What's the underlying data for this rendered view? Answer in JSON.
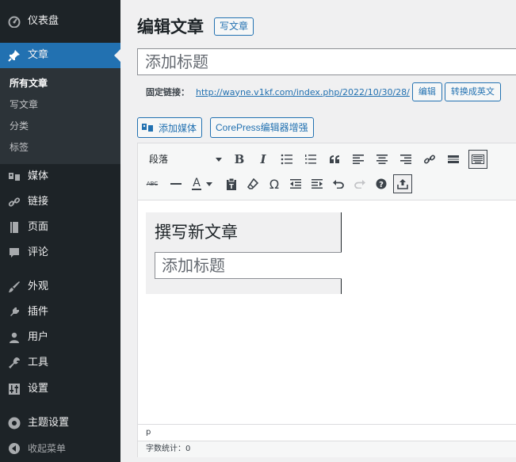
{
  "sidebar": {
    "items": [
      {
        "label": "仪表盘",
        "icon": "dashboard-icon"
      },
      {
        "label": "文章",
        "icon": "pin-icon",
        "active": true
      },
      {
        "label": "媒体",
        "icon": "media-icon"
      },
      {
        "label": "链接",
        "icon": "link-icon"
      },
      {
        "label": "页面",
        "icon": "page-icon"
      },
      {
        "label": "评论",
        "icon": "comment-icon"
      },
      {
        "label": "外观",
        "icon": "brush-icon"
      },
      {
        "label": "插件",
        "icon": "plugin-icon"
      },
      {
        "label": "用户",
        "icon": "user-icon"
      },
      {
        "label": "工具",
        "icon": "wrench-icon"
      },
      {
        "label": "设置",
        "icon": "settings-icon"
      },
      {
        "label": "主题设置",
        "icon": "theme-settings-icon"
      },
      {
        "label": "收起菜单",
        "icon": "collapse-icon"
      }
    ],
    "submenu": [
      {
        "label": "所有文章",
        "current": true
      },
      {
        "label": "写文章"
      },
      {
        "label": "分类"
      },
      {
        "label": "标签"
      }
    ]
  },
  "header": {
    "title": "编辑文章",
    "add_new_label": "写文章"
  },
  "title_field": {
    "placeholder": "添加标题"
  },
  "permalink": {
    "label": "固定链接：",
    "url": "http://wayne.v1kf.com/index.php/2022/10/30/28/",
    "edit_label": "编辑",
    "convert_label": "转换成英文"
  },
  "media": {
    "add_media_label": "添加媒体",
    "corepress_label": "CorePress编辑器增强"
  },
  "toolbar": {
    "format_select": "段落",
    "buttons_row1": [
      "bold",
      "italic",
      "bullet-list",
      "numbered-list",
      "blockquote",
      "align-left",
      "align-center",
      "align-right",
      "link",
      "read-more",
      "toolbar-toggle"
    ],
    "buttons_row2": [
      "strikethrough",
      "horizontal-line",
      "text-color",
      "paste-as-text",
      "clear-formatting",
      "special-character",
      "outdent",
      "indent",
      "undo",
      "redo",
      "help",
      "upload"
    ],
    "bold_label": "B",
    "italic_label": "I",
    "text_color_label": "A",
    "special_char_label": "Ω",
    "strike_label": "ABC"
  },
  "editor_content": {
    "embed_title": "撰写新文章",
    "embed_placeholder": "添加标题"
  },
  "path_bar": "p",
  "status_bar": "字数统计：0",
  "colors": {
    "sidebar_bg": "#1d2327",
    "submenu_bg": "#2c3338",
    "active_bg": "#2271b1",
    "accent": "#2271b1"
  }
}
